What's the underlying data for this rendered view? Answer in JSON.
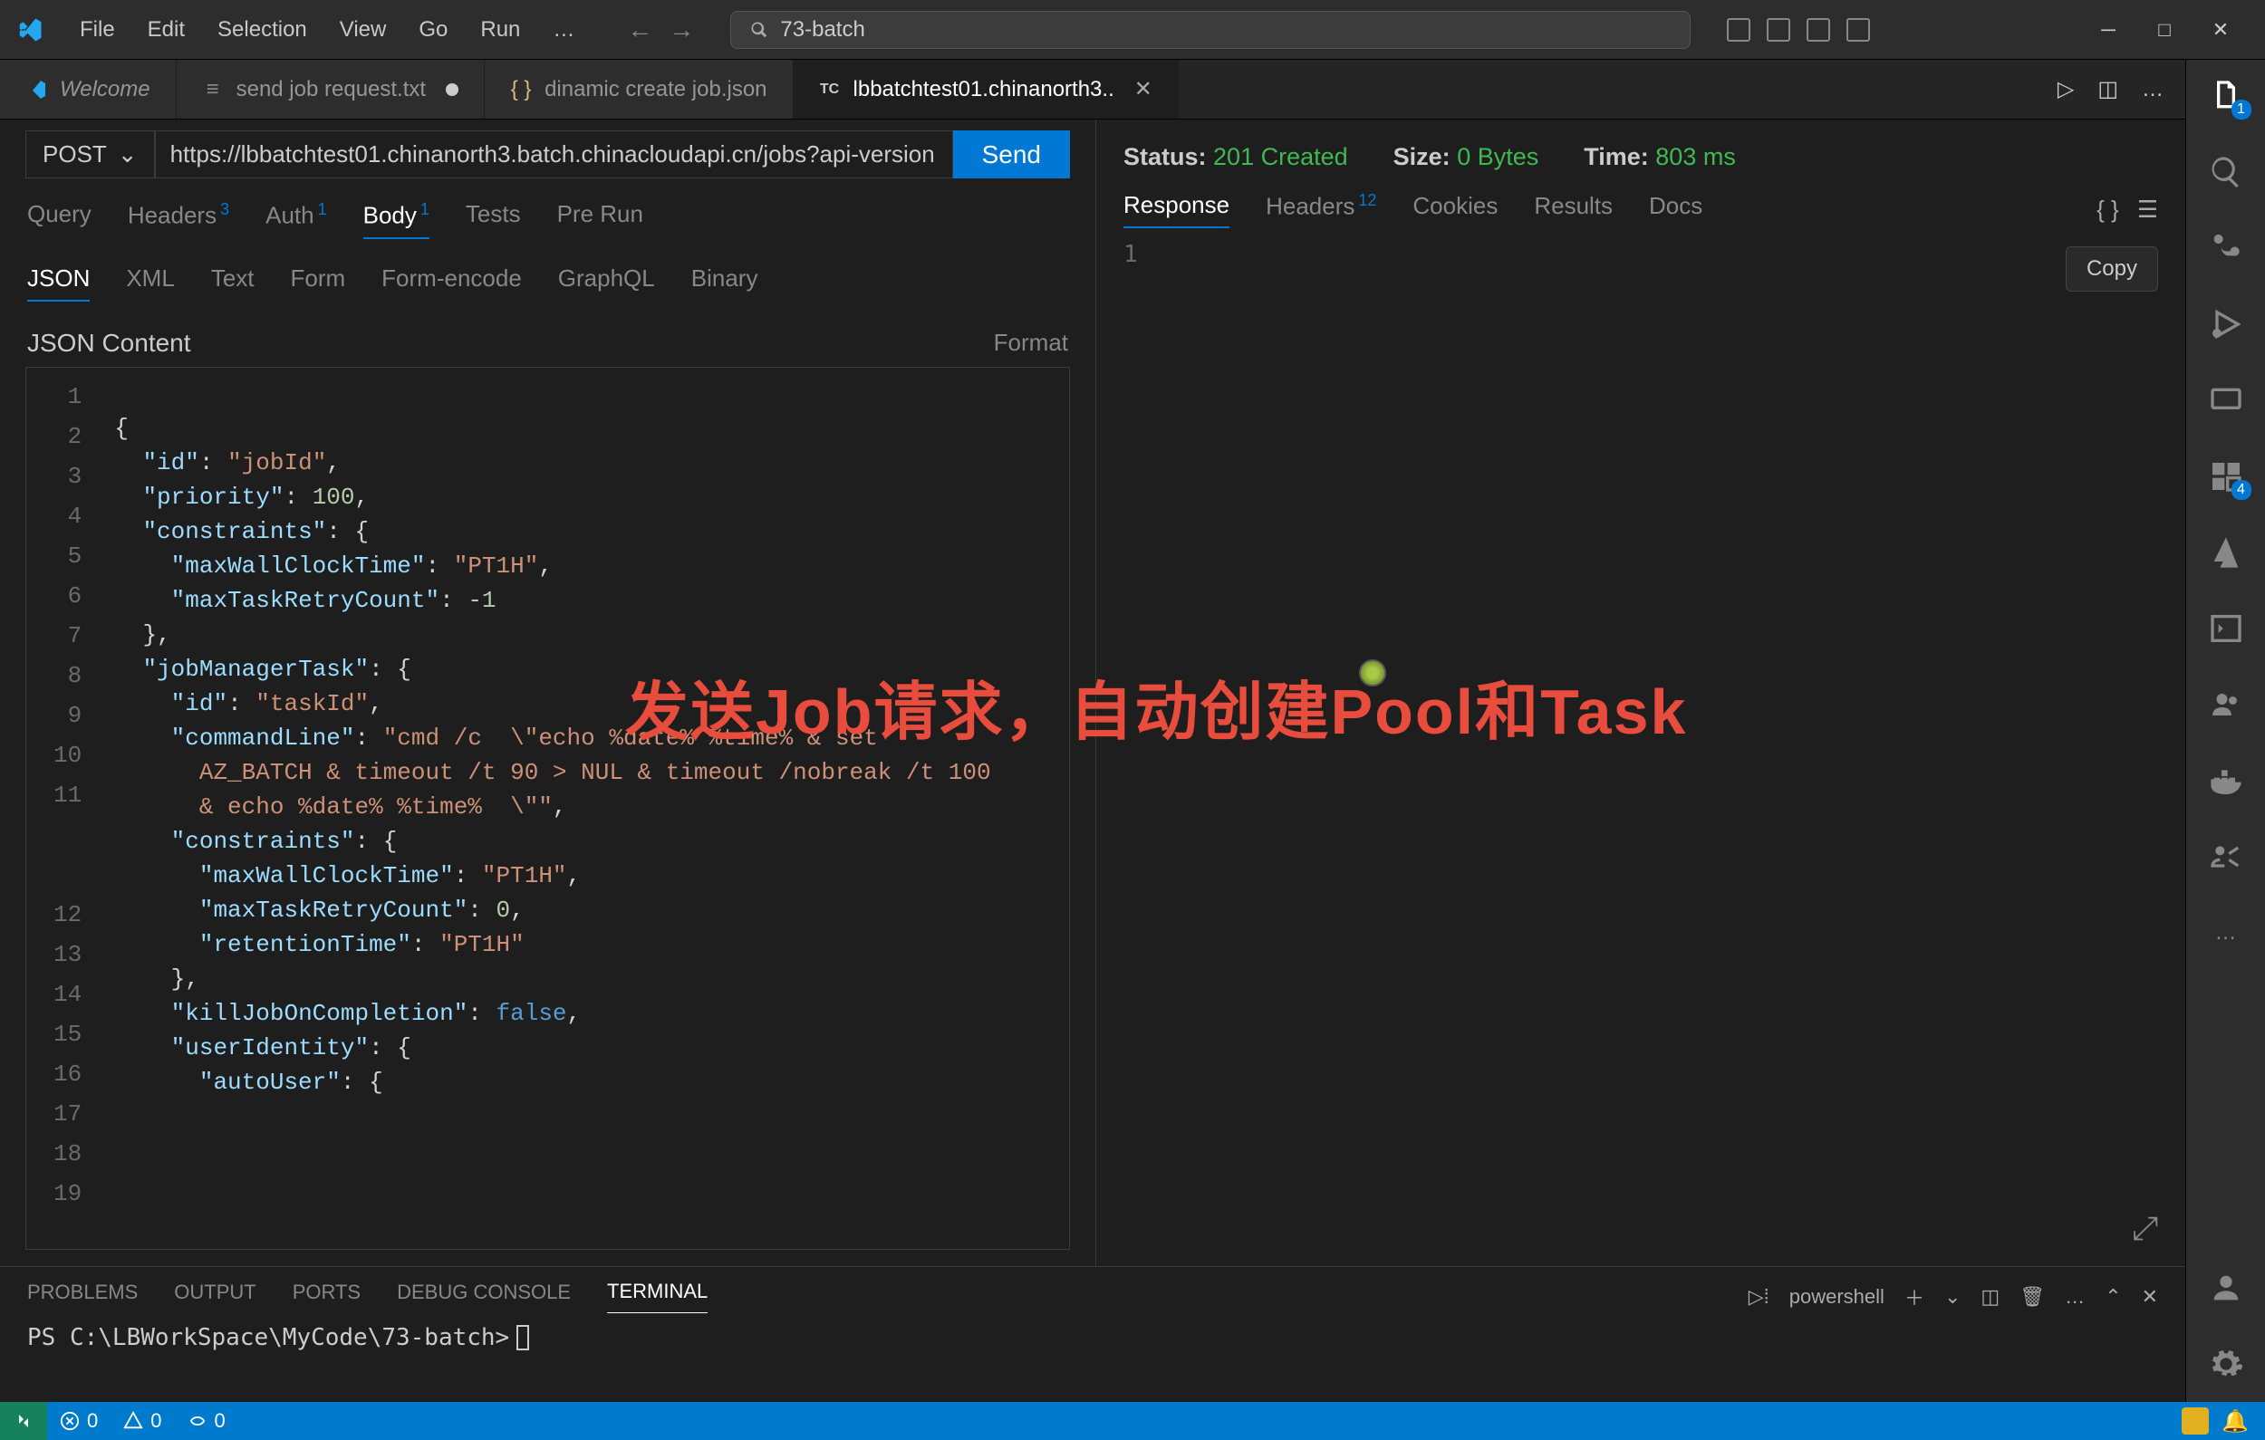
{
  "menubar": [
    "File",
    "Edit",
    "Selection",
    "View",
    "Go",
    "Run"
  ],
  "search_placeholder": "73-batch",
  "tabs": [
    {
      "label": "Welcome",
      "icon": "vscode",
      "dirty": false,
      "active": false
    },
    {
      "label": "send job request.txt",
      "icon": "lines",
      "dirty": true,
      "active": false
    },
    {
      "label": "dinamic create job.json",
      "icon": "braces",
      "dirty": false,
      "active": false
    },
    {
      "label": "lbbatchtest01.chinanorth3..",
      "icon": "tc",
      "dirty": false,
      "active": true
    }
  ],
  "request": {
    "method": "POST",
    "url": "https://lbbatchtest01.chinanorth3.batch.chinacloudapi.cn/jobs?api-version",
    "send": "Send"
  },
  "req_tabs": {
    "items": [
      "Query",
      "Headers",
      "Auth",
      "Body",
      "Tests",
      "Pre Run"
    ],
    "active": "Body",
    "badges": {
      "Headers": "3",
      "Auth": "1",
      "Body": "1"
    }
  },
  "body_types": {
    "items": [
      "JSON",
      "XML",
      "Text",
      "Form",
      "Form-encode",
      "GraphQL",
      "Binary"
    ],
    "active": "JSON"
  },
  "content_label": "JSON Content",
  "format_label": "Format",
  "code_lines": [
    "",
    "{",
    "  \"id\": \"jobId\",",
    "  \"priority\": 100,",
    "  \"constraints\": {",
    "    \"maxWallClockTime\": \"PT1H\",",
    "    \"maxTaskRetryCount\": -1",
    "  },",
    "  \"jobManagerTask\": {",
    "    \"id\": \"taskId\",",
    "    \"commandLine\": \"cmd /c  \\\"echo %date% %time% & set AZ_BATCH & timeout /t 90 > NUL & timeout /nobreak /t 100 & echo %date% %time%  \\\"\",",
    "    \"constraints\": {",
    "      \"maxWallClockTime\": \"PT1H\",",
    "      \"maxTaskRetryCount\": 0,",
    "      \"retentionTime\": \"PT1H\"",
    "    },",
    "    \"killJobOnCompletion\": false,",
    "    \"userIdentity\": {",
    "      \"autoUser\": {"
  ],
  "response": {
    "status_label": "Status:",
    "status_value": "201 Created",
    "size_label": "Size:",
    "size_value": "0 Bytes",
    "time_label": "Time:",
    "time_value": "803 ms",
    "tabs": [
      "Response",
      "Headers",
      "Cookies",
      "Results",
      "Docs"
    ],
    "active_tab": "Response",
    "headers_badge": "12",
    "copy": "Copy",
    "body_line1": "1"
  },
  "overlay": "发送Job请求，自动创建Pool和Task",
  "panel": {
    "tabs": [
      "PROBLEMS",
      "OUTPUT",
      "PORTS",
      "DEBUG CONSOLE",
      "TERMINAL"
    ],
    "active": "TERMINAL",
    "shell": "powershell",
    "prompt": "PS C:\\LBWorkSpace\\MyCode\\73-batch>"
  },
  "statusbar": {
    "errors": "0",
    "warnings": "0",
    "ports": "0"
  },
  "sidebar_badges": {
    "files": "1",
    "extensions": "4"
  }
}
